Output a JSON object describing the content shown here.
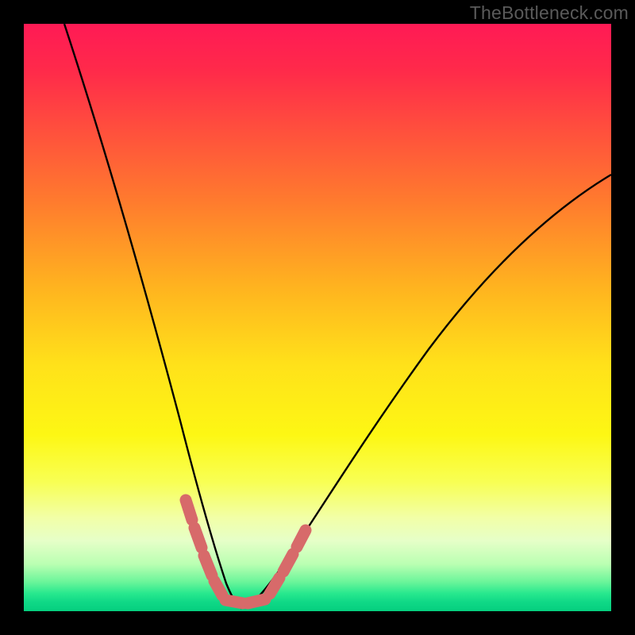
{
  "watermark": "TheBottleneck.com",
  "chart_data": {
    "type": "line",
    "title": "",
    "xlabel": "",
    "ylabel": "",
    "xlim": [
      0,
      100
    ],
    "ylim": [
      0,
      100
    ],
    "series": [
      {
        "name": "bottleneck-curve-left",
        "x": [
          7,
          16,
          22,
          26,
          29,
          31,
          33,
          34.5,
          35.5
        ],
        "y": [
          100,
          64,
          41,
          25,
          14,
          8,
          4,
          1.5,
          0.5
        ]
      },
      {
        "name": "bottleneck-curve-right",
        "x": [
          35.5,
          40,
          45,
          52,
          60,
          72,
          85,
          100
        ],
        "y": [
          0.5,
          2,
          8,
          20,
          33,
          50,
          63,
          74
        ]
      },
      {
        "name": "sweet-spot-marker-left",
        "x": [
          27.5,
          28.5,
          30,
          31.5,
          33
        ],
        "y": [
          19,
          14,
          8,
          4.5,
          2
        ]
      },
      {
        "name": "sweet-spot-marker-bottom",
        "x": [
          33,
          35,
          37,
          39,
          40.5
        ],
        "y": [
          1.2,
          0.8,
          0.8,
          1.2,
          2
        ]
      },
      {
        "name": "sweet-spot-marker-right",
        "x": [
          40.5,
          42,
          43.5,
          45,
          46.5
        ],
        "y": [
          2.5,
          4.5,
          7,
          10,
          13
        ]
      }
    ],
    "colors": {
      "curve": "#000000",
      "marker": "#d76a6a"
    }
  }
}
